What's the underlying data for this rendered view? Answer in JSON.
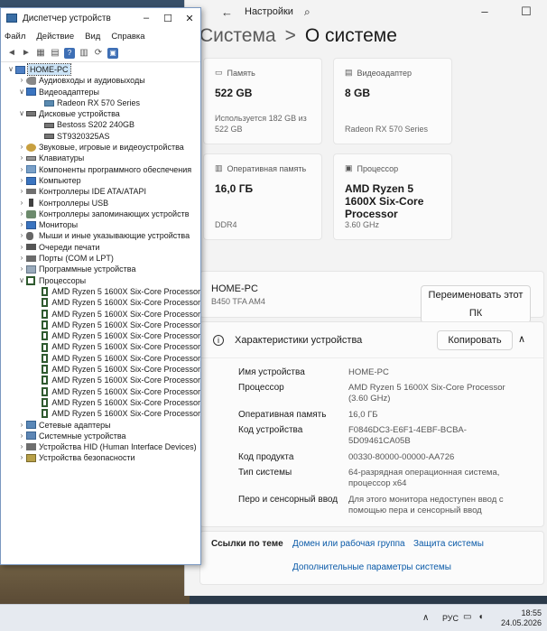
{
  "settings": {
    "title": "Настройки",
    "heading_parent": "Система",
    "heading_sep": ">",
    "heading_current": "О системе",
    "cards": [
      {
        "label": "Память",
        "value": "522 GB",
        "sub": "Используется 182 GB из 522 GB",
        "icon": "storage-icon"
      },
      {
        "label": "Видеоадаптер",
        "value": "8 GB",
        "sub": "Radeon RX 570 Series",
        "icon": "gpu-icon"
      },
      {
        "label": "Оперативная память",
        "value": "16,0 ГБ",
        "sub": "DDR4",
        "icon": "ram-icon"
      },
      {
        "label": "Процессор",
        "value": "AMD Ryzen 5 1600X Six-Core Processor",
        "sub": "3.60 GHz",
        "icon": "cpu-icon"
      }
    ],
    "pc_name": "HOME-PC",
    "board": "B450 TFA AM4",
    "rename_button": "Переименовать этот ПК",
    "specs_title": "Характеристики устройства",
    "copy_button": "Копировать",
    "specs": [
      {
        "key": "Имя устройства",
        "value": "HOME-PC"
      },
      {
        "key": "Процессор",
        "value": "AMD Ryzen 5 1600X Six-Core Processor (3.60 GHz)"
      },
      {
        "key": "Оперативная память",
        "value": "16,0 ГБ"
      },
      {
        "key": "Код устройства",
        "value": "F0846DC3-E6F1-4EBF-BCBA-5D09461CA05B"
      },
      {
        "key": "Код продукта",
        "value": "00330-80000-00000-AA726"
      },
      {
        "key": "Тип системы",
        "value": "64-разрядная операционная система, процессор x64"
      },
      {
        "key": "Перо и сенсорный ввод",
        "value": "Для этого монитора недоступен ввод с помощью пера и сенсорный ввод"
      }
    ],
    "links_label": "Ссылки по теме",
    "links": [
      "Домен или рабочая группа",
      "Защита системы",
      "Дополнительные параметры системы"
    ]
  },
  "devmgr": {
    "title": "Диспетчер устройств",
    "menu": [
      "Файл",
      "Действие",
      "Вид",
      "Справка"
    ],
    "root": "HOME-PC",
    "tree": [
      {
        "label": "Аудиовходы и аудиовыходы",
        "icon": "spk",
        "expanded": false,
        "children": []
      },
      {
        "label": "Видеоадаптеры",
        "icon": "mon",
        "expanded": true,
        "children": [
          {
            "label": "Radeon RX 570 Series",
            "icon": "gpu"
          }
        ]
      },
      {
        "label": "Дисковые устройства",
        "icon": "disk",
        "expanded": true,
        "children": [
          {
            "label": "Bestoss S202 240GB",
            "icon": "disk"
          },
          {
            "label": "ST9320325AS",
            "icon": "disk"
          }
        ]
      },
      {
        "label": "Звуковые, игровые и видеоустройства",
        "icon": "snd",
        "expanded": false,
        "children": []
      },
      {
        "label": "Клавиатуры",
        "icon": "kbd",
        "expanded": false,
        "children": []
      },
      {
        "label": "Компоненты программного обеспечения",
        "icon": "sw",
        "expanded": false,
        "children": []
      },
      {
        "label": "Компьютер",
        "icon": "mon",
        "expanded": false,
        "children": []
      },
      {
        "label": "Контроллеры IDE ATA/ATAPI",
        "icon": "ide",
        "expanded": false,
        "children": []
      },
      {
        "label": "Контроллеры USB",
        "icon": "usb",
        "expanded": false,
        "children": []
      },
      {
        "label": "Контроллеры запоминающих устройств",
        "icon": "stor",
        "expanded": false,
        "children": []
      },
      {
        "label": "Мониторы",
        "icon": "mon",
        "expanded": false,
        "children": []
      },
      {
        "label": "Мыши и иные указывающие устройства",
        "icon": "mouse",
        "expanded": false,
        "children": []
      },
      {
        "label": "Очереди печати",
        "icon": "print",
        "expanded": false,
        "children": []
      },
      {
        "label": "Порты (COM и LPT)",
        "icon": "port",
        "expanded": false,
        "children": []
      },
      {
        "label": "Программные устройства",
        "icon": "prog",
        "expanded": false,
        "children": []
      },
      {
        "label": "Процессоры",
        "icon": "cpu",
        "expanded": true,
        "children": [
          {
            "label": "AMD Ryzen 5 1600X Six-Core Processor",
            "icon": "cpu"
          },
          {
            "label": "AMD Ryzen 5 1600X Six-Core Processor",
            "icon": "cpu"
          },
          {
            "label": "AMD Ryzen 5 1600X Six-Core Processor",
            "icon": "cpu"
          },
          {
            "label": "AMD Ryzen 5 1600X Six-Core Processor",
            "icon": "cpu"
          },
          {
            "label": "AMD Ryzen 5 1600X Six-Core Processor",
            "icon": "cpu"
          },
          {
            "label": "AMD Ryzen 5 1600X Six-Core Processor",
            "icon": "cpu"
          },
          {
            "label": "AMD Ryzen 5 1600X Six-Core Processor",
            "icon": "cpu"
          },
          {
            "label": "AMD Ryzen 5 1600X Six-Core Processor",
            "icon": "cpu"
          },
          {
            "label": "AMD Ryzen 5 1600X Six-Core Processor",
            "icon": "cpu"
          },
          {
            "label": "AMD Ryzen 5 1600X Six-Core Processor",
            "icon": "cpu"
          },
          {
            "label": "AMD Ryzen 5 1600X Six-Core Processor",
            "icon": "cpu"
          },
          {
            "label": "AMD Ryzen 5 1600X Six-Core Processor",
            "icon": "cpu"
          }
        ]
      },
      {
        "label": "Сетевые адаптеры",
        "icon": "net",
        "expanded": false,
        "children": []
      },
      {
        "label": "Системные устройства",
        "icon": "sys",
        "expanded": false,
        "children": []
      },
      {
        "label": "Устройства HID (Human Interface Devices)",
        "icon": "hid",
        "expanded": false,
        "children": []
      },
      {
        "label": "Устройства безопасности",
        "icon": "sec",
        "expanded": false,
        "children": []
      }
    ]
  },
  "taskbar": {
    "lang": "РУС",
    "time": "18:55",
    "date": "24.05.2026"
  }
}
